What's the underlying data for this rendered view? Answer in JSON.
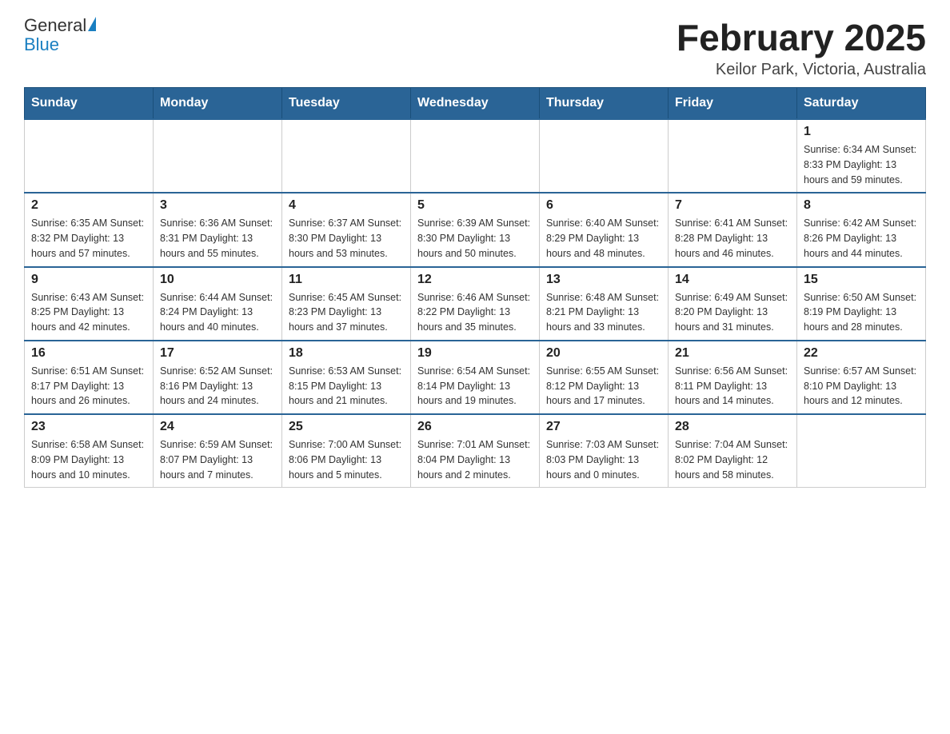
{
  "logo": {
    "general": "General",
    "blue": "Blue"
  },
  "title": "February 2025",
  "subtitle": "Keilor Park, Victoria, Australia",
  "days_of_week": [
    "Sunday",
    "Monday",
    "Tuesday",
    "Wednesday",
    "Thursday",
    "Friday",
    "Saturday"
  ],
  "weeks": [
    {
      "days": [
        {
          "number": "",
          "info": ""
        },
        {
          "number": "",
          "info": ""
        },
        {
          "number": "",
          "info": ""
        },
        {
          "number": "",
          "info": ""
        },
        {
          "number": "",
          "info": ""
        },
        {
          "number": "",
          "info": ""
        },
        {
          "number": "1",
          "info": "Sunrise: 6:34 AM\nSunset: 8:33 PM\nDaylight: 13 hours and 59 minutes."
        }
      ]
    },
    {
      "days": [
        {
          "number": "2",
          "info": "Sunrise: 6:35 AM\nSunset: 8:32 PM\nDaylight: 13 hours and 57 minutes."
        },
        {
          "number": "3",
          "info": "Sunrise: 6:36 AM\nSunset: 8:31 PM\nDaylight: 13 hours and 55 minutes."
        },
        {
          "number": "4",
          "info": "Sunrise: 6:37 AM\nSunset: 8:30 PM\nDaylight: 13 hours and 53 minutes."
        },
        {
          "number": "5",
          "info": "Sunrise: 6:39 AM\nSunset: 8:30 PM\nDaylight: 13 hours and 50 minutes."
        },
        {
          "number": "6",
          "info": "Sunrise: 6:40 AM\nSunset: 8:29 PM\nDaylight: 13 hours and 48 minutes."
        },
        {
          "number": "7",
          "info": "Sunrise: 6:41 AM\nSunset: 8:28 PM\nDaylight: 13 hours and 46 minutes."
        },
        {
          "number": "8",
          "info": "Sunrise: 6:42 AM\nSunset: 8:26 PM\nDaylight: 13 hours and 44 minutes."
        }
      ]
    },
    {
      "days": [
        {
          "number": "9",
          "info": "Sunrise: 6:43 AM\nSunset: 8:25 PM\nDaylight: 13 hours and 42 minutes."
        },
        {
          "number": "10",
          "info": "Sunrise: 6:44 AM\nSunset: 8:24 PM\nDaylight: 13 hours and 40 minutes."
        },
        {
          "number": "11",
          "info": "Sunrise: 6:45 AM\nSunset: 8:23 PM\nDaylight: 13 hours and 37 minutes."
        },
        {
          "number": "12",
          "info": "Sunrise: 6:46 AM\nSunset: 8:22 PM\nDaylight: 13 hours and 35 minutes."
        },
        {
          "number": "13",
          "info": "Sunrise: 6:48 AM\nSunset: 8:21 PM\nDaylight: 13 hours and 33 minutes."
        },
        {
          "number": "14",
          "info": "Sunrise: 6:49 AM\nSunset: 8:20 PM\nDaylight: 13 hours and 31 minutes."
        },
        {
          "number": "15",
          "info": "Sunrise: 6:50 AM\nSunset: 8:19 PM\nDaylight: 13 hours and 28 minutes."
        }
      ]
    },
    {
      "days": [
        {
          "number": "16",
          "info": "Sunrise: 6:51 AM\nSunset: 8:17 PM\nDaylight: 13 hours and 26 minutes."
        },
        {
          "number": "17",
          "info": "Sunrise: 6:52 AM\nSunset: 8:16 PM\nDaylight: 13 hours and 24 minutes."
        },
        {
          "number": "18",
          "info": "Sunrise: 6:53 AM\nSunset: 8:15 PM\nDaylight: 13 hours and 21 minutes."
        },
        {
          "number": "19",
          "info": "Sunrise: 6:54 AM\nSunset: 8:14 PM\nDaylight: 13 hours and 19 minutes."
        },
        {
          "number": "20",
          "info": "Sunrise: 6:55 AM\nSunset: 8:12 PM\nDaylight: 13 hours and 17 minutes."
        },
        {
          "number": "21",
          "info": "Sunrise: 6:56 AM\nSunset: 8:11 PM\nDaylight: 13 hours and 14 minutes."
        },
        {
          "number": "22",
          "info": "Sunrise: 6:57 AM\nSunset: 8:10 PM\nDaylight: 13 hours and 12 minutes."
        }
      ]
    },
    {
      "days": [
        {
          "number": "23",
          "info": "Sunrise: 6:58 AM\nSunset: 8:09 PM\nDaylight: 13 hours and 10 minutes."
        },
        {
          "number": "24",
          "info": "Sunrise: 6:59 AM\nSunset: 8:07 PM\nDaylight: 13 hours and 7 minutes."
        },
        {
          "number": "25",
          "info": "Sunrise: 7:00 AM\nSunset: 8:06 PM\nDaylight: 13 hours and 5 minutes."
        },
        {
          "number": "26",
          "info": "Sunrise: 7:01 AM\nSunset: 8:04 PM\nDaylight: 13 hours and 2 minutes."
        },
        {
          "number": "27",
          "info": "Sunrise: 7:03 AM\nSunset: 8:03 PM\nDaylight: 13 hours and 0 minutes."
        },
        {
          "number": "28",
          "info": "Sunrise: 7:04 AM\nSunset: 8:02 PM\nDaylight: 12 hours and 58 minutes."
        },
        {
          "number": "",
          "info": ""
        }
      ]
    }
  ]
}
